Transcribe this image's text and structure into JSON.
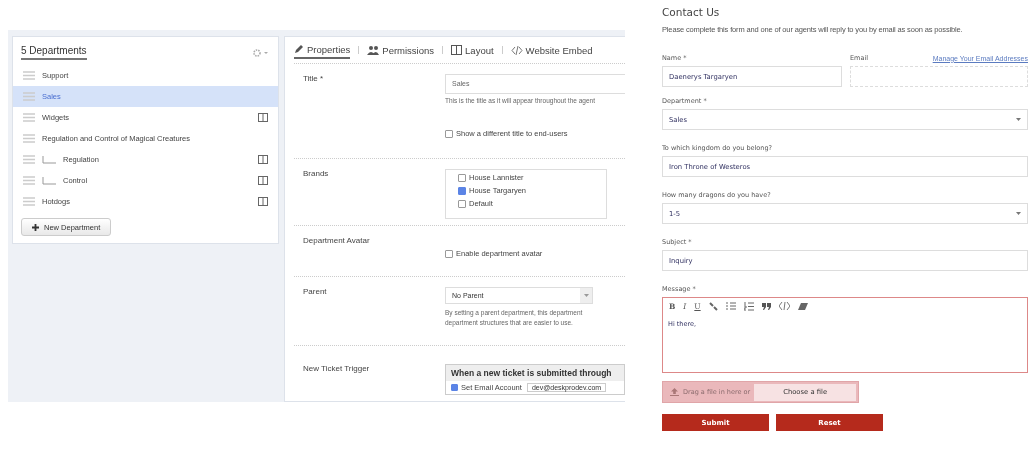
{
  "departments": {
    "title": "5 Departments",
    "items": [
      {
        "name": "Support",
        "selected": false,
        "layout": false
      },
      {
        "name": "Sales",
        "selected": true,
        "layout": false
      },
      {
        "name": "Widgets",
        "selected": false,
        "layout": true
      },
      {
        "name": "Regulation and Control of Magical Creatures",
        "selected": false,
        "layout": false,
        "children": [
          {
            "name": "Regulation",
            "selected": false,
            "layout": true
          },
          {
            "name": "Control",
            "selected": false,
            "layout": true
          }
        ]
      },
      {
        "name": "Hotdogs",
        "selected": false,
        "layout": true
      }
    ],
    "new_button": "New Department"
  },
  "tabs": [
    {
      "label": "Properties",
      "kind": "pencil",
      "selected": true
    },
    {
      "label": "Permissions",
      "kind": "people",
      "selected": false
    },
    {
      "label": "Layout",
      "kind": "columns",
      "selected": false
    },
    {
      "label": "Website Embed",
      "kind": "code",
      "selected": false
    }
  ],
  "properties": {
    "title": {
      "label": "Title *",
      "value": "Sales",
      "help": "This is the title as it will appear throughout the agent",
      "option": {
        "label": "Show a different title to end-users",
        "checked": false
      }
    },
    "brands": {
      "label": "Brands",
      "items": [
        {
          "label": "House Lannister",
          "checked": false
        },
        {
          "label": "House Targaryen",
          "checked": true
        },
        {
          "label": "Default",
          "checked": false
        }
      ]
    },
    "avatar": {
      "label": "Department Avatar",
      "option": {
        "label": "Enable department avatar",
        "checked": false
      }
    },
    "parent": {
      "label": "Parent",
      "value": "No Parent",
      "help": "By setting a parent department, this department",
      "help_2": "department structures that are easier to use."
    },
    "trigger": {
      "label": "New Ticket Trigger",
      "heading": "When a new ticket is submitted through",
      "action": {
        "label": "Set Email Account",
        "checked": true,
        "value": "dev@deskprodev.com"
      }
    }
  },
  "contact": {
    "title": "Contact Us",
    "intro": "Please complete this form and one of our agents will reply to you by email as soon as possible.",
    "name": {
      "label": "Name *",
      "value": "Daenerys Targaryen"
    },
    "email": {
      "label": "Email",
      "link": "Manage Your Email Addresses"
    },
    "fields": [
      {
        "label": "Department *",
        "value": "Sales",
        "kind": "select"
      },
      {
        "label": "To which kingdom do you belong?",
        "value": "Iron Throne of Westeros",
        "kind": "text"
      },
      {
        "label": "How many dragons do you have?",
        "value": "1-5",
        "kind": "select"
      },
      {
        "label": "Subject *",
        "value": "Inquiry",
        "kind": "text"
      }
    ],
    "message": {
      "label": "Message *",
      "value": "Hi there,",
      "toolbar": [
        {
          "kind": "letter",
          "label": "B"
        },
        {
          "kind": "letter",
          "label": "I"
        },
        {
          "kind": "letter",
          "label": "U"
        },
        {
          "kind": "link"
        },
        {
          "kind": "bullets"
        },
        {
          "kind": "numbers"
        },
        {
          "kind": "quote"
        },
        {
          "kind": "code"
        },
        {
          "kind": "eraser"
        }
      ]
    },
    "upload": {
      "hint": "Drag a file in here or",
      "button": "Choose a file"
    },
    "buttons": [
      "Submit",
      "Reset"
    ]
  }
}
